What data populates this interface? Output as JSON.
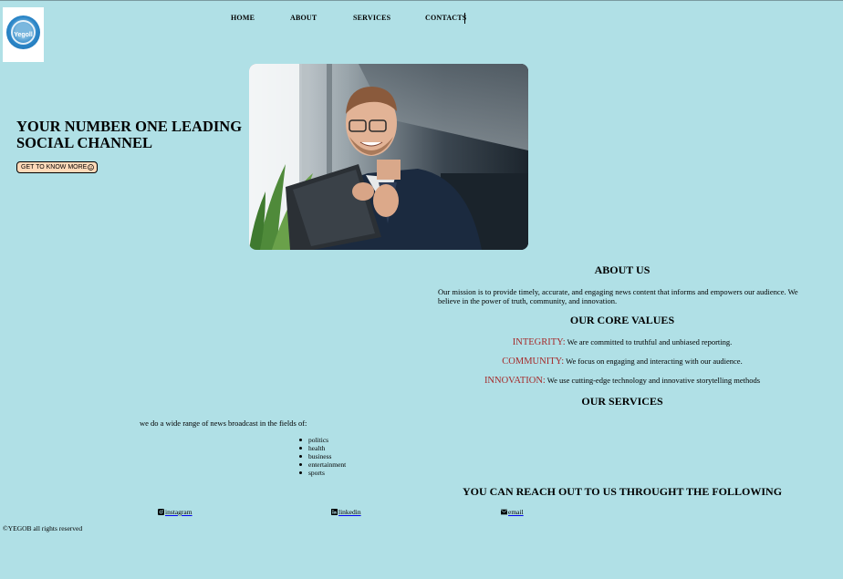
{
  "logo": {
    "text": "Yegoll",
    "icon": "headset-logo"
  },
  "nav": {
    "home": "HOME",
    "about": "ABOUT",
    "services": "SERVICES",
    "contacts": "CONTACTS"
  },
  "hero": {
    "title": "YOUR NUMBER ONE LEADING SOCIAL CHANNEL",
    "button": "GET TO KNOW MORE",
    "button_icon": "smiley-icon",
    "image": "smiling man in glasses holding a tablet"
  },
  "about": {
    "heading": "ABOUT US",
    "mission": "Our mission is to provide timely, accurate, and engaging news content that informs and empowers our audience. We believe in the power of truth, community, and innovation."
  },
  "values": {
    "heading": "OUR CORE VALUES",
    "items": [
      {
        "name": "INTEGRITY:",
        "text": " We are committed to truthful and unbiased reporting."
      },
      {
        "name": "COMMUNITY:",
        "text": " We focus on engaging and interacting with our audience."
      },
      {
        "name": "INNOVATION:",
        "text": " We use cutting-edge technology and innovative storytelling methods"
      }
    ]
  },
  "services": {
    "heading": "OUR SERVICES",
    "intro": "we do a wide range of news broadcast in the fields of:",
    "list": [
      "politics",
      "health",
      "business",
      "entertainment",
      "sports"
    ]
  },
  "contact": {
    "heading": "YOU CAN REACH OUT TO US THROUGHT THE FOLLOWING",
    "links": [
      {
        "label": "instagram",
        "icon": "instagram-icon"
      },
      {
        "label": "linkedin",
        "icon": "linkedin-icon"
      },
      {
        "label": "email",
        "icon": "envelope-icon"
      }
    ]
  },
  "footer": {
    "text": "©YEGOB all rights reserved"
  },
  "colors": {
    "background": "#b0e0e6",
    "button": "#ffdab9",
    "value_name": "#a52a2a"
  }
}
